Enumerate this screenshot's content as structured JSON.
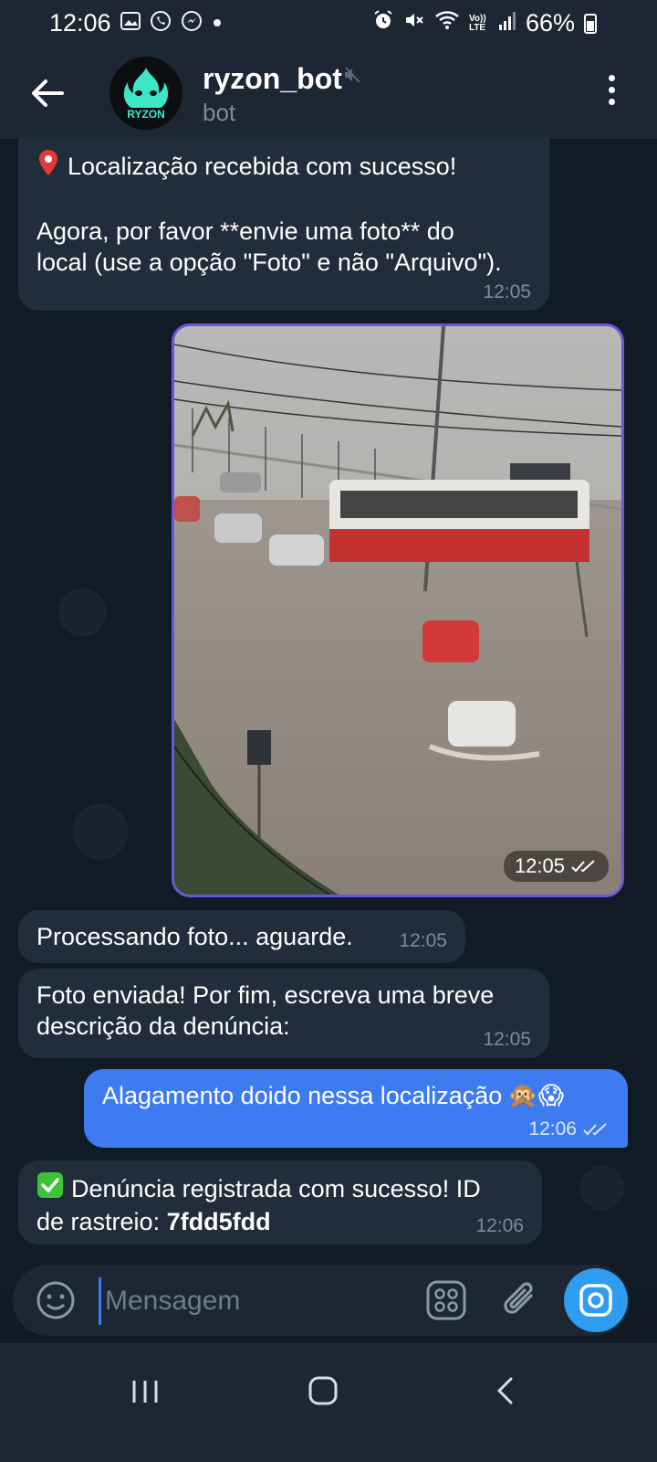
{
  "status_bar": {
    "time": "12:06",
    "battery": "66%",
    "left_icons": [
      "gallery-icon",
      "whatsapp-icon",
      "messenger-icon",
      "dot-icon"
    ],
    "right_icons": [
      "alarm-icon",
      "mute-icon",
      "wifi-icon",
      "volte-icon",
      "signal-icon",
      "battery-icon"
    ],
    "volte_label": "Vo)) LTE"
  },
  "header": {
    "title": "ryzon_bot",
    "subtitle": "bot",
    "avatar_text": "RYZON",
    "accent": "#3ee6c8"
  },
  "messages": [
    {
      "id": "m1",
      "direction": "in",
      "icon": "pin-icon",
      "line1": "Localização recebida com sucesso!",
      "line2": "Agora, por favor **envie uma foto** do",
      "line3": "local (use a opção \"Foto\" e não \"Arquivo\").",
      "time": "12:05"
    },
    {
      "id": "m2",
      "direction": "out",
      "type": "photo",
      "time": "12:05",
      "read": true
    },
    {
      "id": "m3",
      "direction": "in",
      "text": "Processando foto... aguarde.",
      "time": "12:05"
    },
    {
      "id": "m4",
      "direction": "in",
      "line1": "Foto enviada! Por fim, escreva uma breve",
      "line2": "descrição da denúncia:",
      "time": "12:05"
    },
    {
      "id": "m5",
      "direction": "out",
      "text": "Alagamento doido nessa localização",
      "emojis": "🙊😱",
      "time": "12:06",
      "read": true
    },
    {
      "id": "m6",
      "direction": "in",
      "icon": "check-icon",
      "line1": "Denúncia registrada com sucesso! ID",
      "line2_prefix": "de rastreio: ",
      "tracking_id": "7fdd5fdd",
      "time": "12:06"
    }
  ],
  "input": {
    "placeholder": "Mensagem"
  },
  "colors": {
    "incoming_bubble": "#212d3b",
    "outgoing_bubble": "#3e7bf0",
    "background": "#101b26",
    "photo_border": "#6a56d8",
    "camera_button": "#2f9cf0"
  }
}
